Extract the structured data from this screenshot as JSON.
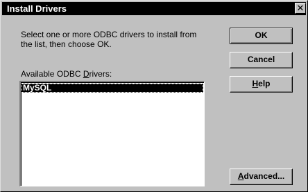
{
  "window": {
    "title": "Install Drivers",
    "close_glyph": "✕"
  },
  "instruction": "Select one or more ODBC drivers to install from the list, then choose OK.",
  "drivers_label": {
    "before": "Available ODBC ",
    "mnemonic": "D",
    "after": "rivers:"
  },
  "drivers": [
    {
      "label": "MySQL",
      "selected": true
    }
  ],
  "buttons": {
    "ok": "OK",
    "cancel": "Cancel",
    "help": {
      "mnemonic": "H",
      "rest": "elp"
    },
    "advanced": {
      "mnemonic": "A",
      "rest": "dvanced..."
    }
  }
}
